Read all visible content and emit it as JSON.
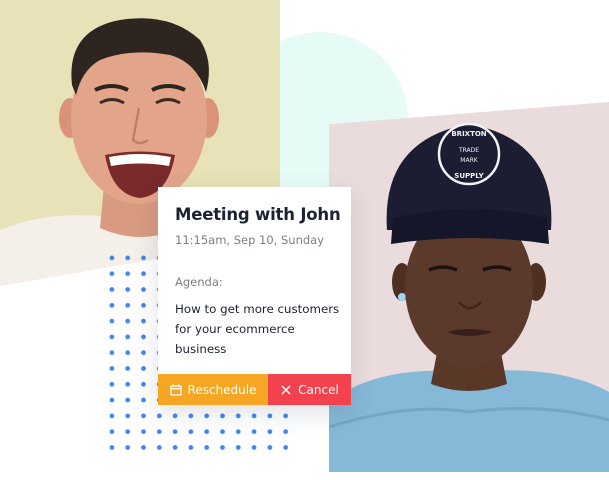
{
  "meeting": {
    "title": "Meeting with John",
    "time": "11:15am, Sep 10, Sunday",
    "agenda_label": "Agenda:",
    "agenda_text": "How to get more customers for your ecommerce business"
  },
  "actions": {
    "reschedule_label": "Reschedule",
    "cancel_label": "Cancel"
  },
  "cap": {
    "brand_top": "BRIXTON",
    "brand_mid1": "TRADE",
    "brand_mid2": "MARK",
    "brand_bottom": "SUPPLY"
  },
  "colors": {
    "reschedule": "#f5a623",
    "cancel": "#f1424e",
    "dots": "#3f88ee",
    "blob": "#e7fbf6",
    "left_photo_bg": "#e8e2b8",
    "right_photo_bg": "#eadcdc"
  },
  "icons": {
    "reschedule": "calendar-icon",
    "cancel": "close-icon"
  }
}
